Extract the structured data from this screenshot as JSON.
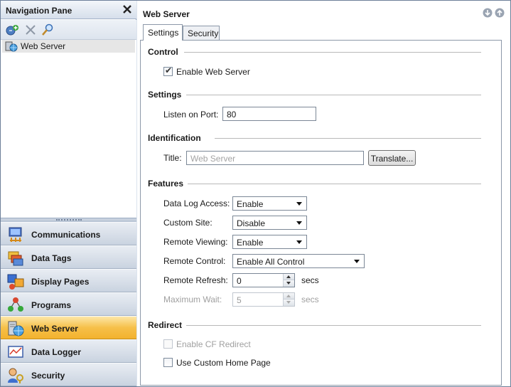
{
  "nav": {
    "title": "Navigation Pane",
    "toolbar_icons": [
      "add-icon",
      "delete-icon",
      "find-icon"
    ],
    "tree_item": "Web Server",
    "buttons": [
      {
        "label": "Communications",
        "icon": "communications-icon"
      },
      {
        "label": "Data Tags",
        "icon": "data-tags-icon"
      },
      {
        "label": "Display Pages",
        "icon": "display-pages-icon"
      },
      {
        "label": "Programs",
        "icon": "programs-icon"
      },
      {
        "label": "Web Server",
        "icon": "web-server-icon",
        "active": true
      },
      {
        "label": "Data Logger",
        "icon": "data-logger-icon"
      },
      {
        "label": "Security",
        "icon": "security-icon"
      }
    ]
  },
  "main": {
    "title": "Web Server",
    "tabs": [
      "Settings",
      "Security"
    ],
    "active_tab": "Settings"
  },
  "control": {
    "title": "Control",
    "enable_label": "Enable Web Server",
    "enable_checked": true
  },
  "settings": {
    "title": "Settings",
    "port_label": "Listen on Port:",
    "port_value": "80"
  },
  "identification": {
    "title": "Identification",
    "title_label": "Title:",
    "title_placeholder": "Web Server",
    "translate_button": "Translate..."
  },
  "features": {
    "title": "Features",
    "data_log_label": "Data Log Access:",
    "data_log_value": "Enable",
    "custom_site_label": "Custom Site:",
    "custom_site_value": "Disable",
    "remote_viewing_label": "Remote Viewing:",
    "remote_viewing_value": "Enable",
    "remote_control_label": "Remote Control:",
    "remote_control_value": "Enable All Control",
    "remote_refresh_label": "Remote Refresh:",
    "remote_refresh_value": "0",
    "remote_refresh_unit": "secs",
    "max_wait_label": "Maximum Wait:",
    "max_wait_value": "5",
    "max_wait_unit": "secs"
  },
  "redirect": {
    "title": "Redirect",
    "cf_label": "Enable CF Redirect",
    "cf_checked": false,
    "custom_home_label": "Use Custom Home Page",
    "custom_home_checked": false
  },
  "colors": {
    "active_nav": "#f6c04a",
    "frame": "#6d7f99"
  }
}
